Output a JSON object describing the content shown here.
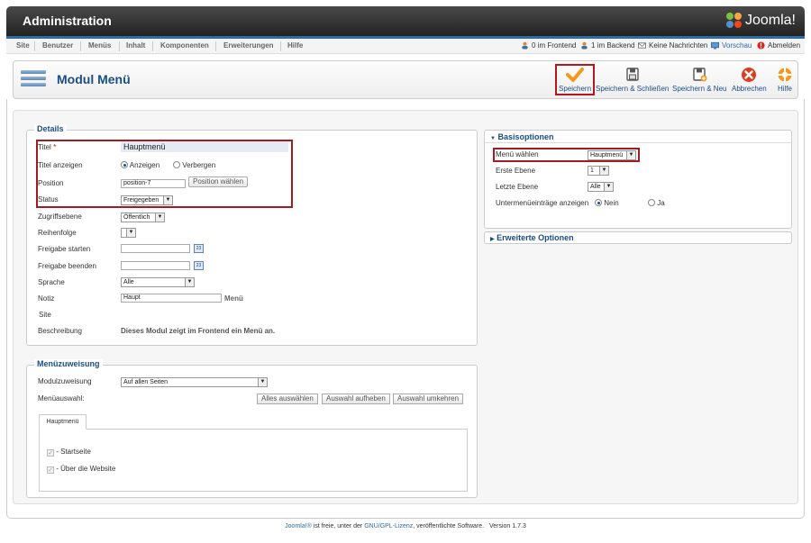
{
  "header": {
    "title": "Administration",
    "logo_text": "Joomla!"
  },
  "menubar": {
    "items": [
      "Site",
      "Benutzer",
      "Menüs",
      "Inhalt",
      "Komponenten",
      "Erweiterungen",
      "Hilfe"
    ],
    "status": {
      "frontend": "0 im Frontend",
      "backend": "1 im Backend",
      "messages": "Keine Nachrichten",
      "preview": "Vorschau",
      "logout": "Abmelden"
    }
  },
  "toolbar": {
    "page_title": "Modul Menü",
    "save": "Speichern",
    "save_close": "Speichern & Schließen",
    "save_new": "Speichern & Neu",
    "cancel": "Abbrechen",
    "help": "Hilfe"
  },
  "details": {
    "legend": "Details",
    "title_label": "Titel",
    "required_mark": "*",
    "title_value": "Hauptmenü",
    "show_title_label": "Titel anzeigen",
    "show_title_opt1": "Anzeigen",
    "show_title_opt2": "Verbergen",
    "position_label": "Position",
    "position_value": "position-7",
    "position_button": "Position wählen",
    "status_label": "Status",
    "status_value": "Freigegeben",
    "access_label": "Zugriffsebene",
    "access_value": "Öffentlich",
    "order_label": "Reihenfolge",
    "publish_up_label": "Freigabe starten",
    "publish_down_label": "Freigabe beenden",
    "calendar_label": "23",
    "language_label": "Sprache",
    "language_value": "Alle",
    "note_label": "Notiz",
    "note_value": "Haupt",
    "note_suffix": "Menü",
    "site_label": "Site",
    "description_label": "Beschreibung",
    "description_value": "Dieses Modul zeigt im Frontend ein Menü an."
  },
  "assignment": {
    "legend": "Menüzuweisung",
    "module_assign_label": "Modulzuweisung",
    "module_assign_value": "Auf allen Seiten",
    "selection_label": "Menüauswahl:",
    "btn_select_all": "Alles auswählen",
    "btn_deselect": "Auswahl aufheben",
    "btn_invert": "Auswahl umkehren",
    "tab": "Hauptmenü",
    "items": [
      "- Startseite",
      "- Über die Website"
    ]
  },
  "basic": {
    "header": "Basisoptionen",
    "menu_label": "Menü wählen",
    "menu_value": "Hauptmenü",
    "start_label": "Erste Ebene",
    "start_value": "1",
    "end_label": "Letzte Ebene",
    "end_value": "Alle",
    "sub_label": "Untermenüeinträge anzeigen",
    "sub_opt1": "Nein",
    "sub_opt2": "Ja"
  },
  "advanced": {
    "header": "Erweiterte Optionen"
  },
  "footer": {
    "joomla": "Joomla!®",
    "text1": " ist freie, unter der ",
    "license": "GNU/GPL-Lizenz",
    "text2": ", veröffentlichte Software.",
    "version": "Version 1.7.3"
  },
  "colors": {
    "accent": "#1a4d87",
    "highlight": "#a31a23",
    "header_bg": "#333333"
  }
}
